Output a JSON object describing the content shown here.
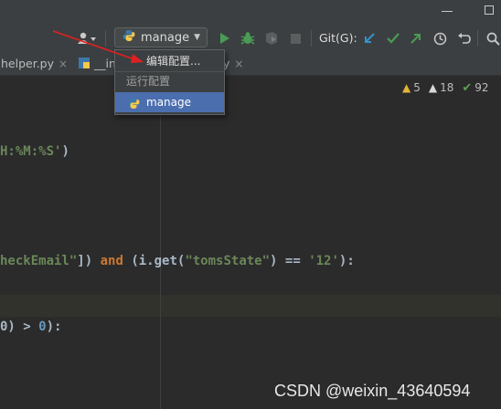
{
  "toolbar": {
    "run_config_label": "manage",
    "git_label": "Git(G):"
  },
  "tabs": [
    {
      "label": "helper.py",
      "close": "×"
    },
    {
      "label": "__in",
      "close": ""
    },
    {
      "label": "y",
      "close": "×"
    }
  ],
  "inspections": {
    "warnings": "5",
    "weak_warnings": "18",
    "ok": "92"
  },
  "dropdown": {
    "edit_configurations": "编辑配置...",
    "section_header": "运行配置",
    "selected_config": "manage"
  },
  "code": {
    "line1": "H:%M:%S'",
    "line1_close": ")",
    "line2_a": "heckEmail\"",
    "line2_b": "]) ",
    "line2_and": "and",
    "line2_c": " (i.get(",
    "line2_d": "\"tomsState\"",
    "line2_e": ") == ",
    "line2_f": "'12'",
    "line2_g": "):",
    "line3_a": "0) > ",
    "line3_b": "0",
    "line3_c": "):"
  },
  "watermark": "CSDN @weixin_43640594",
  "colors": {
    "background": "#2b2b2b",
    "toolbar": "#3c3f41",
    "run_green": "#499c54",
    "vcs_blue": "#3592c4",
    "selection": "#4b6eaf",
    "annotation_arrow": "#e02020"
  }
}
